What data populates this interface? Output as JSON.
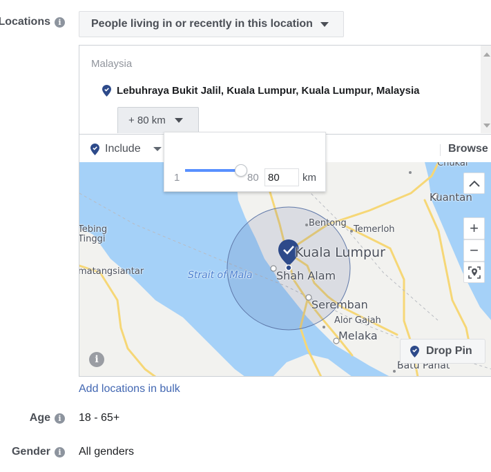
{
  "locations": {
    "label": "Locations",
    "type_selector": "People living in or recently in this location",
    "country": "Malaysia",
    "selected_location": "Lebuhraya Bukit Jalil, Kuala Lumpur, Kuala Lumpur, Malaysia",
    "radius_button": "+ 80 km",
    "include_label": "Include",
    "browse_label": "Browse",
    "radius_slider": {
      "min": "1",
      "max": "80",
      "value": "80",
      "unit": "km",
      "fraction": 1.0
    },
    "map": {
      "labels": {
        "chukai": "Chukai",
        "kuantan": "Kuantan",
        "tebing_tinggi_1": "Tebing",
        "tebing_tinggi_2": "Tinggi",
        "bentong": "Bentong",
        "temerloh": "Temerloh",
        "kuala_lumpur": "Kuala Lumpur",
        "pematangsiantar": "matangsiantar",
        "strait": "Strait of Mala",
        "shah_alam": "Shah Alam",
        "seremban": "Seremban",
        "alor_gajah": "Alor Gajah",
        "melaka": "Melaka",
        "batu_pahat": "Batu Pahat"
      },
      "controls": {
        "collapse": "^",
        "zoom_in": "+",
        "zoom_out": "−"
      },
      "drop_pin_label": "Drop Pin",
      "info_glyph": "i"
    },
    "bulk_link": "Add locations in bulk"
  },
  "age": {
    "label": "Age",
    "value": "18 - 65+"
  },
  "gender": {
    "label": "Gender",
    "value": "All genders"
  },
  "icons": {
    "info_glyph": "i"
  },
  "colors": {
    "accent_blue": "#4267b2",
    "pin_navy": "#2d4a8a",
    "slider_blue": "#5890ff",
    "water": "#a5d1f8"
  }
}
